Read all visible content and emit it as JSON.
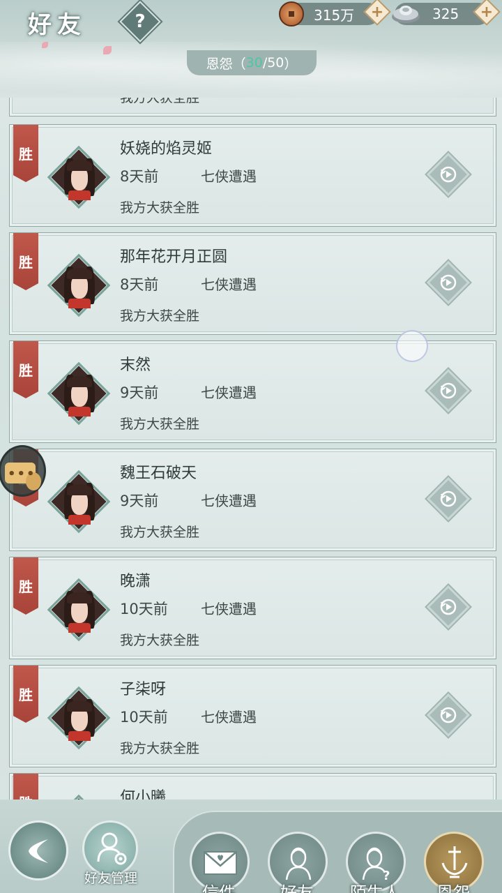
{
  "header": {
    "title": "好友",
    "help_label": "?",
    "copper": "315万",
    "silver": "325",
    "add_label": "+",
    "tab_label": "恩怨",
    "tab_count_current": "30",
    "tab_count_sep": "/50",
    "tab_paren_open": "（",
    "tab_paren_close": "）"
  },
  "list": {
    "items": [
      {
        "result_tag": "胜",
        "name": "妖娆的焰灵姬",
        "time": "8天前",
        "mode": "七侠遭遇",
        "result": "我方大获全胜"
      },
      {
        "result_tag": "胜",
        "name": "那年花开月正圆",
        "time": "8天前",
        "mode": "七侠遭遇",
        "result": "我方大获全胜"
      },
      {
        "result_tag": "胜",
        "name": "末然",
        "time": "9天前",
        "mode": "七侠遭遇",
        "result": "我方大获全胜"
      },
      {
        "result_tag": "胜",
        "name": "魏王石破天",
        "time": "9天前",
        "mode": "七侠遭遇",
        "result": "我方大获全胜"
      },
      {
        "result_tag": "胜",
        "name": "晚潇",
        "time": "10天前",
        "mode": "七侠遭遇",
        "result": "我方大获全胜"
      },
      {
        "result_tag": "胜",
        "name": "子柒呀",
        "time": "10天前",
        "mode": "七侠遭遇",
        "result": "我方大获全胜"
      },
      {
        "result_tag": "胜",
        "name": "何小曦",
        "time": "",
        "mode": "",
        "result": ""
      }
    ],
    "partial_top_result": "我方大获全胜"
  },
  "bottom_nav": {
    "manage_label": "好友管理",
    "tabs": [
      {
        "label": "信件"
      },
      {
        "label": "好友"
      },
      {
        "label": "陌生人"
      },
      {
        "label": "恩怨"
      }
    ]
  },
  "colors": {
    "accent_count": "#4ac8a6",
    "win_tag": "#b24a3e"
  }
}
